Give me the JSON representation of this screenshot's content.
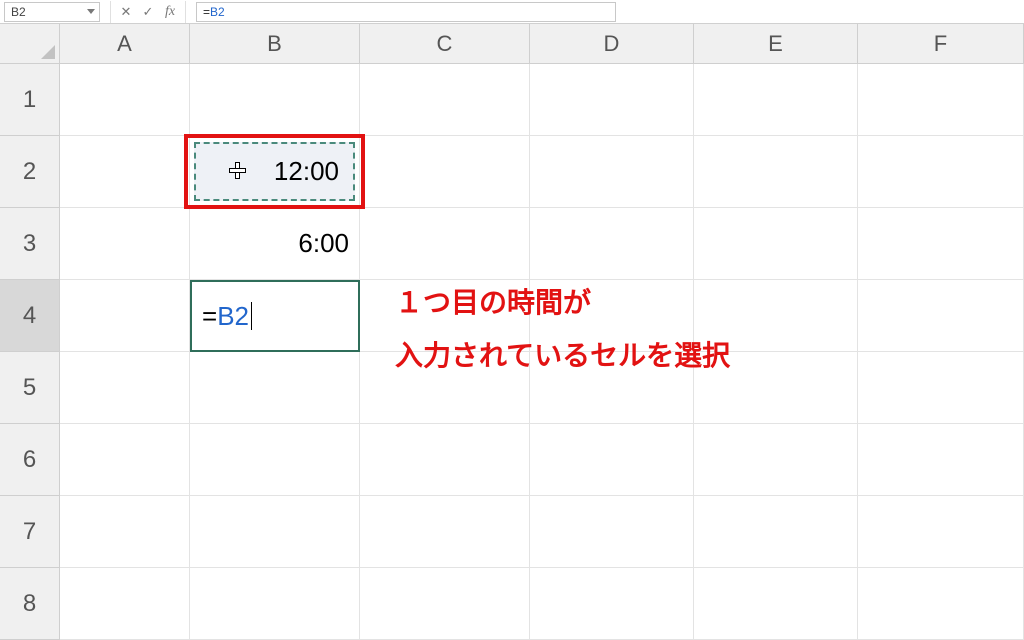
{
  "formula_bar": {
    "name_box": "B2",
    "cancel_glyph": "✕",
    "enter_glyph": "✓",
    "fx_label": "fx",
    "formula_prefix": "=",
    "formula_ref": "B2"
  },
  "columns": [
    "A",
    "B",
    "C",
    "D",
    "E",
    "F"
  ],
  "rows": [
    "1",
    "2",
    "3",
    "4",
    "5",
    "6",
    "7",
    "8"
  ],
  "active_row": "4",
  "cells": {
    "B2": "12:00",
    "B3": "6:00",
    "B4_prefix": "=",
    "B4_ref": "B2"
  },
  "annotation": {
    "line1": "１つ目の時間が",
    "line2": "入力されているセルを選択"
  }
}
